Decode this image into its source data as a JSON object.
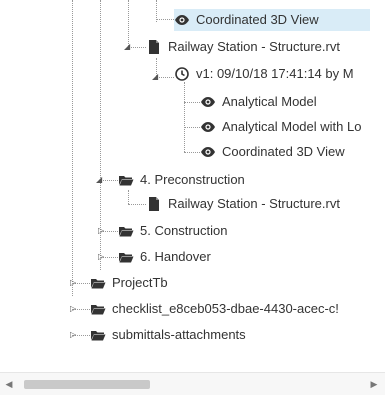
{
  "tree": {
    "items": [
      {
        "label": "Coordinated 3D View",
        "icon": "eye-icon"
      },
      {
        "label": "Railway Station - Structure.rvt",
        "icon": "file-icon"
      },
      {
        "label": "v1: 09/10/18 17:41:14 by M",
        "icon": "clock-icon"
      },
      {
        "label": "Analytical Model",
        "icon": "eye-icon"
      },
      {
        "label": "Analytical Model with Lo",
        "icon": "eye-icon"
      },
      {
        "label": "Coordinated 3D View",
        "icon": "eye-icon"
      },
      {
        "label": "4. Preconstruction",
        "icon": "folder-open-icon"
      },
      {
        "label": "Railway Station - Structure.rvt",
        "icon": "file-icon"
      },
      {
        "label": "5. Construction",
        "icon": "folder-open-icon"
      },
      {
        "label": "6. Handover",
        "icon": "folder-open-icon"
      },
      {
        "label": "ProjectTb",
        "icon": "folder-open-icon"
      },
      {
        "label": "checklist_e8ceb053-dbae-4430-acec-c!",
        "icon": "folder-open-icon"
      },
      {
        "label": "submittals-attachments",
        "icon": "folder-open-icon"
      }
    ]
  },
  "scrollbar": {
    "left_arrow": "◀",
    "right_arrow": "▶"
  },
  "colors": {
    "selected_bg": "#d9ecf7",
    "folder": "#333333",
    "line": "#999999"
  }
}
